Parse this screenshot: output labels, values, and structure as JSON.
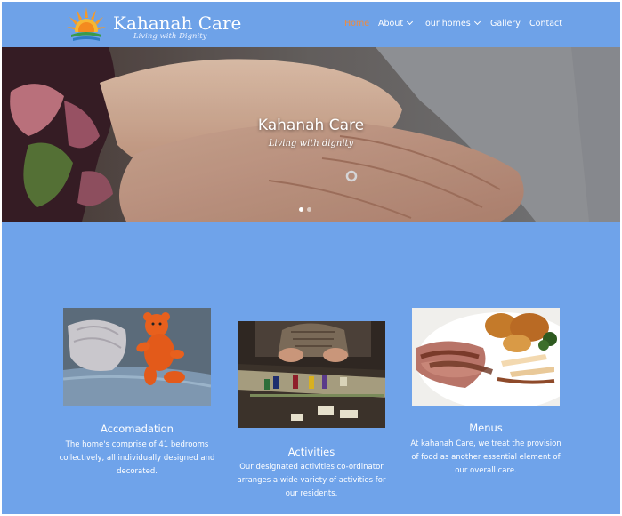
{
  "brand": {
    "name": "Kahanah Care",
    "tagline": "Living with Dignity"
  },
  "nav": {
    "items": [
      {
        "label": "Home",
        "active": true,
        "dropdown": false
      },
      {
        "label": "About",
        "active": false,
        "dropdown": true
      },
      {
        "label": "our homes",
        "active": false,
        "dropdown": true
      },
      {
        "label": "Gallery",
        "active": false,
        "dropdown": false
      },
      {
        "label": "Contact",
        "active": false,
        "dropdown": false
      }
    ]
  },
  "hero": {
    "title": "Kahanah Care",
    "subtitle": "Living with dignity",
    "slide_count": 2,
    "active_slide": 1
  },
  "features": [
    {
      "title": "Accomadation",
      "text": "The home's comprise of 41 bedrooms collectively, all individually designed and decorated."
    },
    {
      "title": "Activities",
      "text": "Our designated activities co-ordinator arranges a wide variety of activities for our residents."
    },
    {
      "title": "Menus",
      "text": "At kahanah Care, we treat the provision of food as another essential element of our overall care."
    }
  ],
  "colors": {
    "background": "#6fa3ea",
    "active_nav": "#f08a3c",
    "text": "#ffffff"
  }
}
